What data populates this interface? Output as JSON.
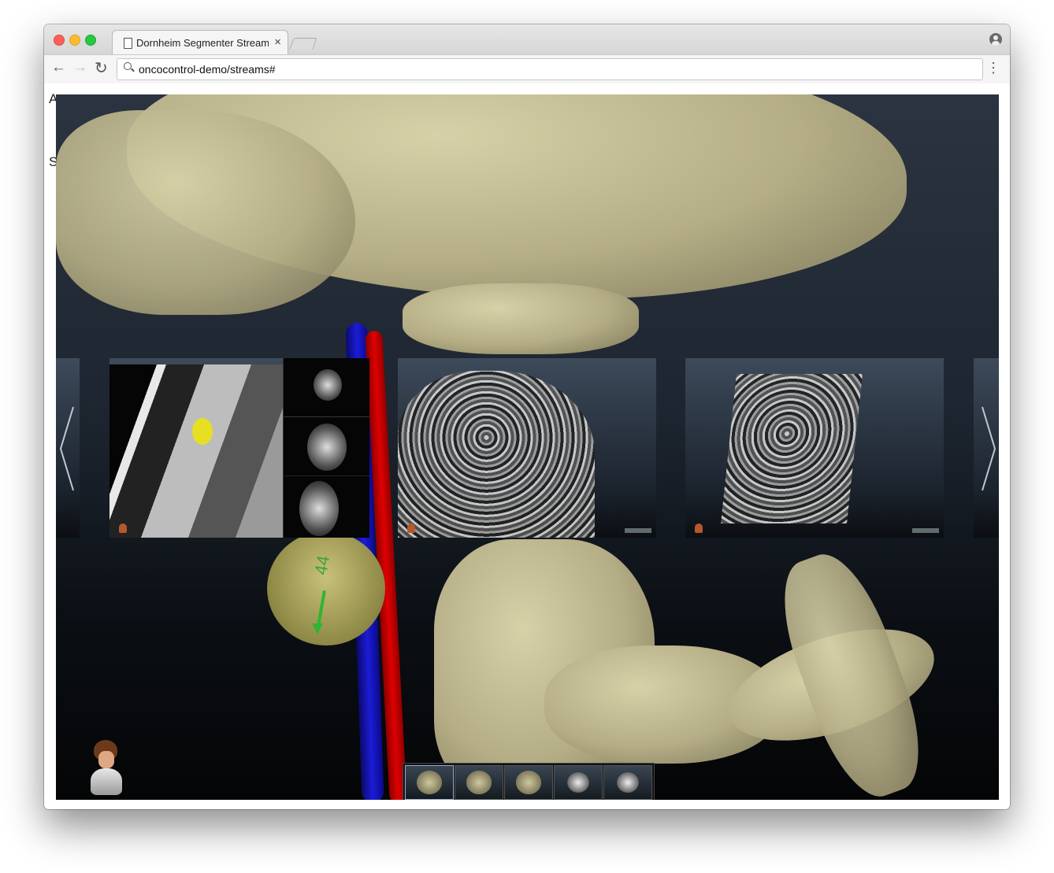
{
  "browser": {
    "tab_title": "Dornheim Segmenter Streaming",
    "tab_close": "×",
    "url": "oncocontrol-demo/streams#",
    "menu_glyph": "⋮",
    "back_glyph": "←",
    "forward_glyph": "→",
    "reload_glyph": "↻"
  },
  "page": {
    "peek_letter_1": "A",
    "peek_letter_2": "S"
  },
  "viewer": {
    "measurement_label": "44",
    "carousel": {
      "cards": [
        {
          "name": "ct-multiplanar-view"
        },
        {
          "name": "volume-rendering-neck"
        },
        {
          "name": "volume-rendering-cut"
        }
      ],
      "prev_icon": "chevron-left-icon",
      "next_icon": "chevron-right-icon"
    },
    "thumbnails": [
      {
        "kind": "bone-3d",
        "active": true
      },
      {
        "kind": "bone-side",
        "active": false
      },
      {
        "kind": "bone-vessels",
        "active": false
      },
      {
        "kind": "ct-slices",
        "active": false
      },
      {
        "kind": "ct-volume",
        "active": false
      }
    ]
  },
  "colors": {
    "bone": "#c9c29b",
    "vein": "#1c1cd6",
    "artery": "#e00000",
    "tumor_marker": "#e6df24",
    "measurement": "#2fb52f",
    "viewer_bg_top": "#2b3440",
    "viewer_bg_bottom": "#040506"
  }
}
